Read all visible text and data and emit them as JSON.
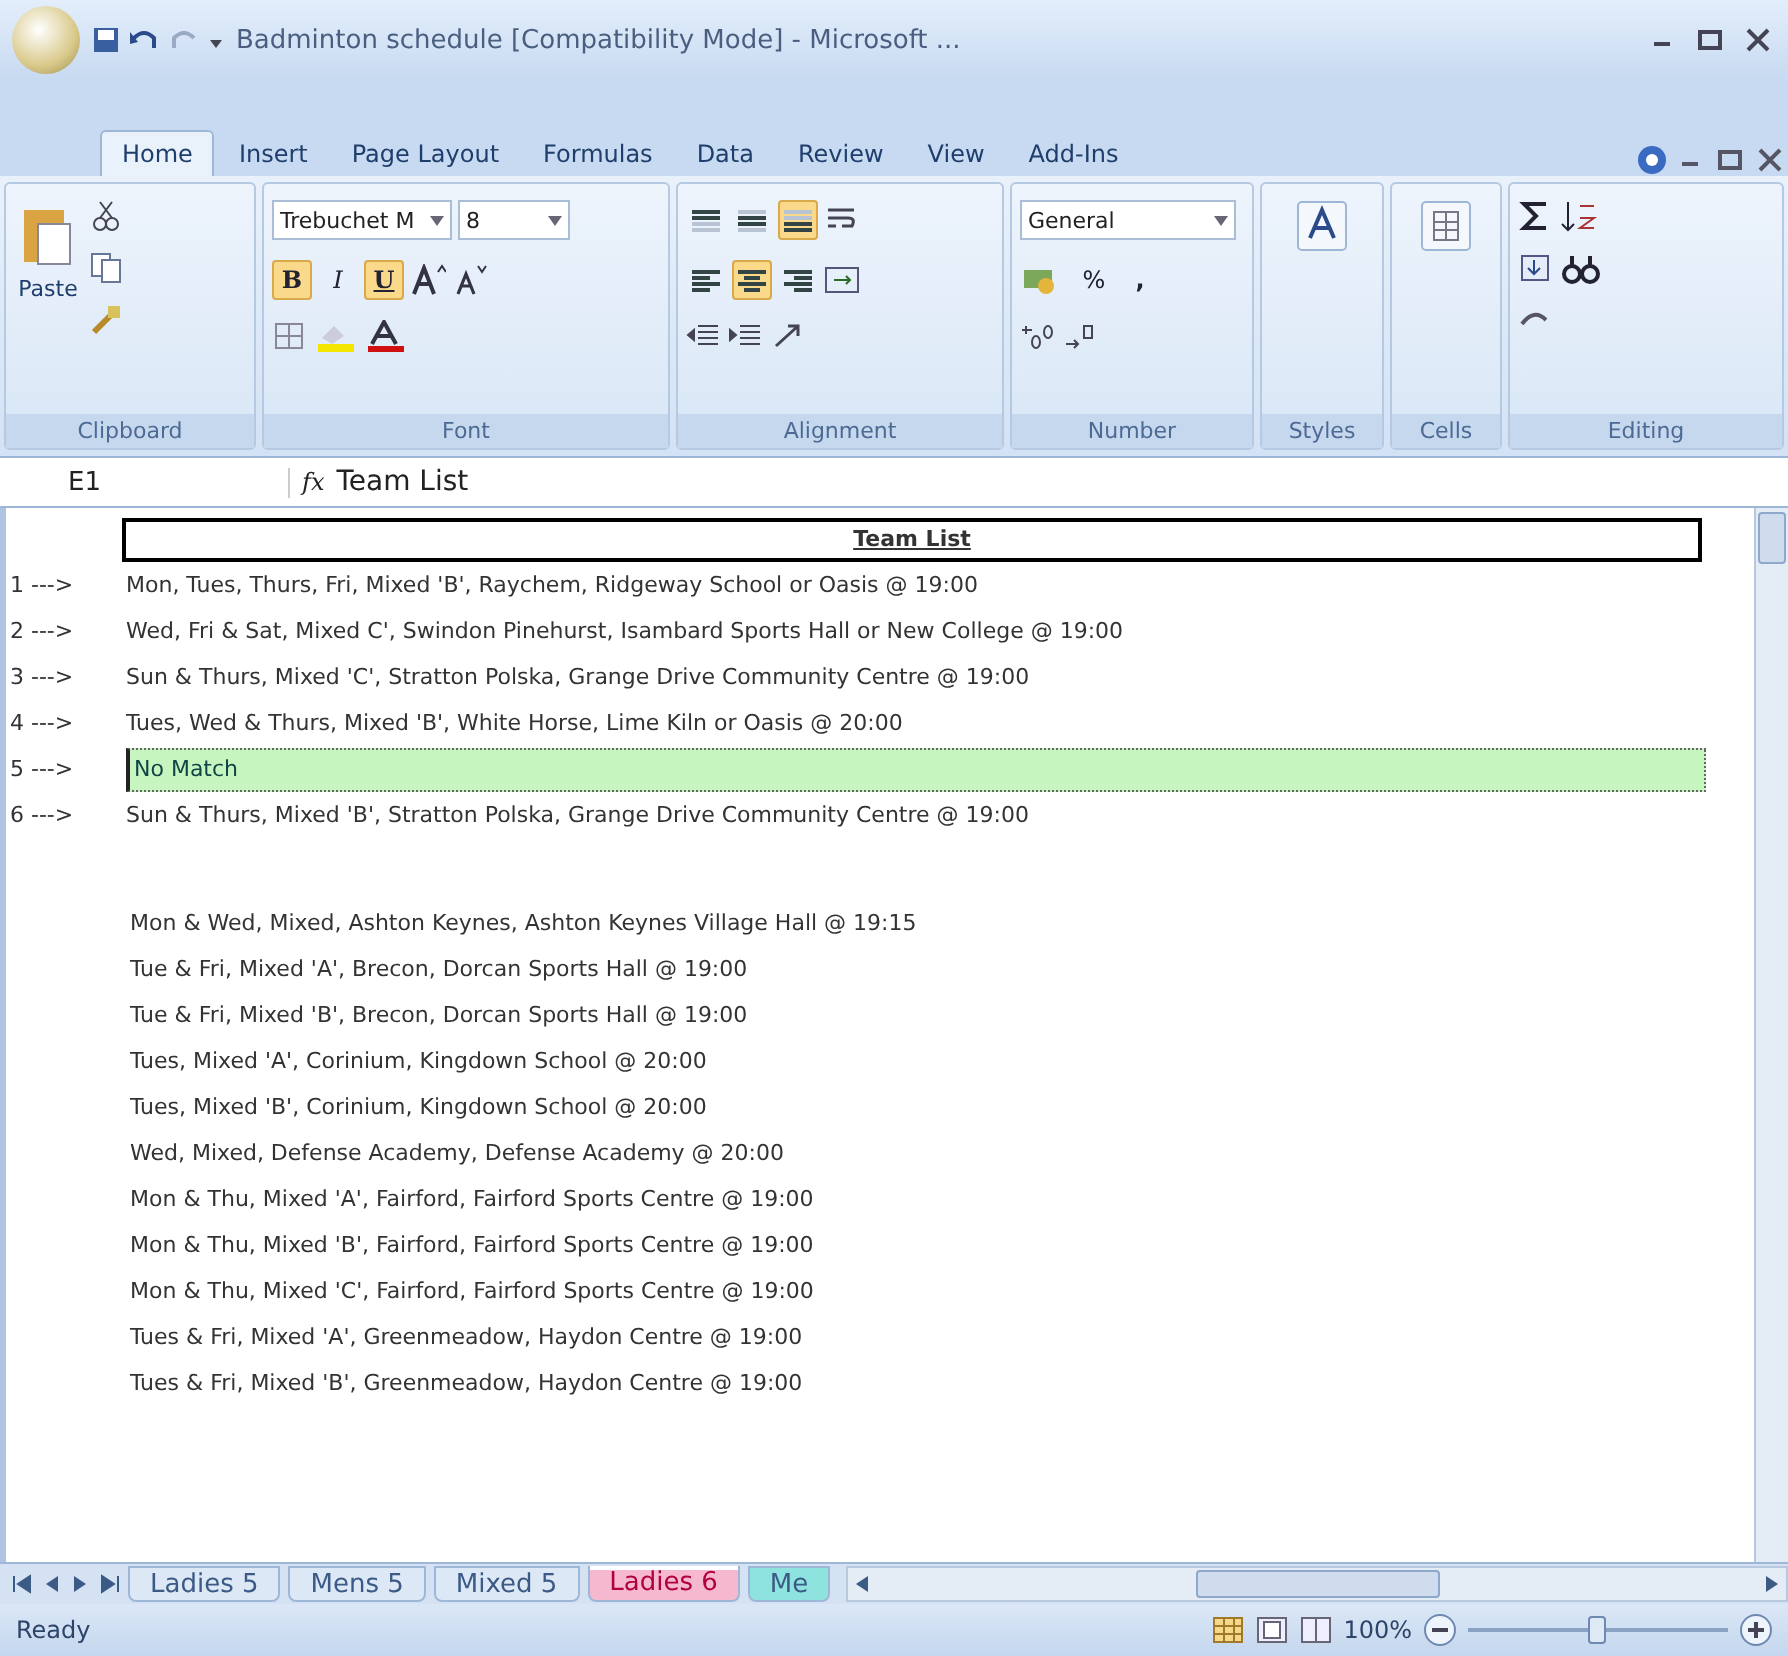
{
  "window": {
    "title": "Badminton schedule  [Compatibility Mode] - Microsoft ..."
  },
  "ribbon_tabs": [
    {
      "label": "Home",
      "selected": true
    },
    {
      "label": "Insert",
      "selected": false
    },
    {
      "label": "Page Layout",
      "selected": false
    },
    {
      "label": "Formulas",
      "selected": false
    },
    {
      "label": "Data",
      "selected": false
    },
    {
      "label": "Review",
      "selected": false
    },
    {
      "label": "View",
      "selected": false
    },
    {
      "label": "Add-Ins",
      "selected": false
    }
  ],
  "ribbon": {
    "clipboard": {
      "label": "Clipboard",
      "paste": "Paste"
    },
    "font": {
      "label": "Font",
      "font_name": "Trebuchet M",
      "font_size": "8",
      "bold": {
        "text": "B",
        "on": true
      },
      "italic": {
        "text": "I",
        "on": false
      },
      "underline": {
        "text": "U",
        "on": true
      }
    },
    "alignment": {
      "label": "Alignment",
      "top": {
        "on": false
      },
      "middle": {
        "on": false
      },
      "bottom": {
        "on": true
      },
      "left": {
        "on": false
      },
      "center": {
        "on": true
      },
      "right": {
        "on": false
      }
    },
    "number": {
      "label": "Number",
      "format": "General",
      "percent": "%",
      "comma": ","
    },
    "styles": {
      "label": "Styles"
    },
    "cells": {
      "label": "Cells"
    },
    "editing": {
      "label": "Editing"
    }
  },
  "formula_bar": {
    "name_box": "E1",
    "fx": "fx",
    "value": "Team List"
  },
  "sheet": {
    "title": "Team List",
    "numbered_rows": [
      {
        "marker": "1 --->",
        "text": "Mon, Tues, Thurs, Fri, Mixed 'B', Raychem, Ridgeway School or Oasis @ 19:00",
        "highlighted": false
      },
      {
        "marker": "2 --->",
        "text": "Wed, Fri & Sat, Mixed C', Swindon Pinehurst, Isambard Sports Hall or New College @ 19:00",
        "highlighted": false
      },
      {
        "marker": "3 --->",
        "text": "Sun & Thurs, Mixed 'C', Stratton Polska, Grange Drive Community Centre @ 19:00",
        "highlighted": false
      },
      {
        "marker": "4 --->",
        "text": "Tues, Wed & Thurs, Mixed 'B', White Horse, Lime Kiln or Oasis @ 20:00",
        "highlighted": false
      },
      {
        "marker": "5 --->",
        "text": "No Match",
        "highlighted": true
      },
      {
        "marker": "6 --->",
        "text": "Sun & Thurs, Mixed 'B', Stratton Polska, Grange Drive Community Centre @ 19:00",
        "highlighted": false
      }
    ],
    "teams": [
      "Mon & Wed, Mixed, Ashton Keynes, Ashton Keynes Village Hall @ 19:15",
      "Tue & Fri, Mixed 'A', Brecon, Dorcan Sports Hall @ 19:00",
      "Tue & Fri, Mixed 'B', Brecon, Dorcan Sports Hall @ 19:00",
      "Tues, Mixed 'A', Corinium, Kingdown School @ 20:00",
      "Tues, Mixed 'B', Corinium, Kingdown School @ 20:00",
      "Wed, Mixed, Defense Academy, Defense Academy @ 20:00",
      "Mon & Thu, Mixed 'A', Fairford, Fairford Sports Centre @ 19:00",
      "Mon & Thu, Mixed 'B', Fairford, Fairford Sports Centre @ 19:00",
      "Mon & Thu, Mixed 'C', Fairford, Fairford Sports Centre @ 19:00",
      "Tues & Fri, Mixed 'A', Greenmeadow, Haydon Centre @ 19:00",
      "Tues & Fri, Mixed 'B', Greenmeadow, Haydon Centre @ 19:00"
    ]
  },
  "sheet_tabs": [
    {
      "label": "Ladies 5",
      "selected": false,
      "color": "#dce8f5"
    },
    {
      "label": "Mens 5",
      "selected": false,
      "color": "#dce8f5"
    },
    {
      "label": "Mixed 5",
      "selected": false,
      "color": "#dce8f5"
    },
    {
      "label": "Ladies 6",
      "selected": true,
      "color": "#f6b8cf"
    },
    {
      "label": "Me",
      "selected": false,
      "color": "#8fe3df"
    }
  ],
  "status_bar": {
    "status": "Ready",
    "zoom": "100%",
    "zoom_slider": {
      "level": 0.5
    }
  }
}
